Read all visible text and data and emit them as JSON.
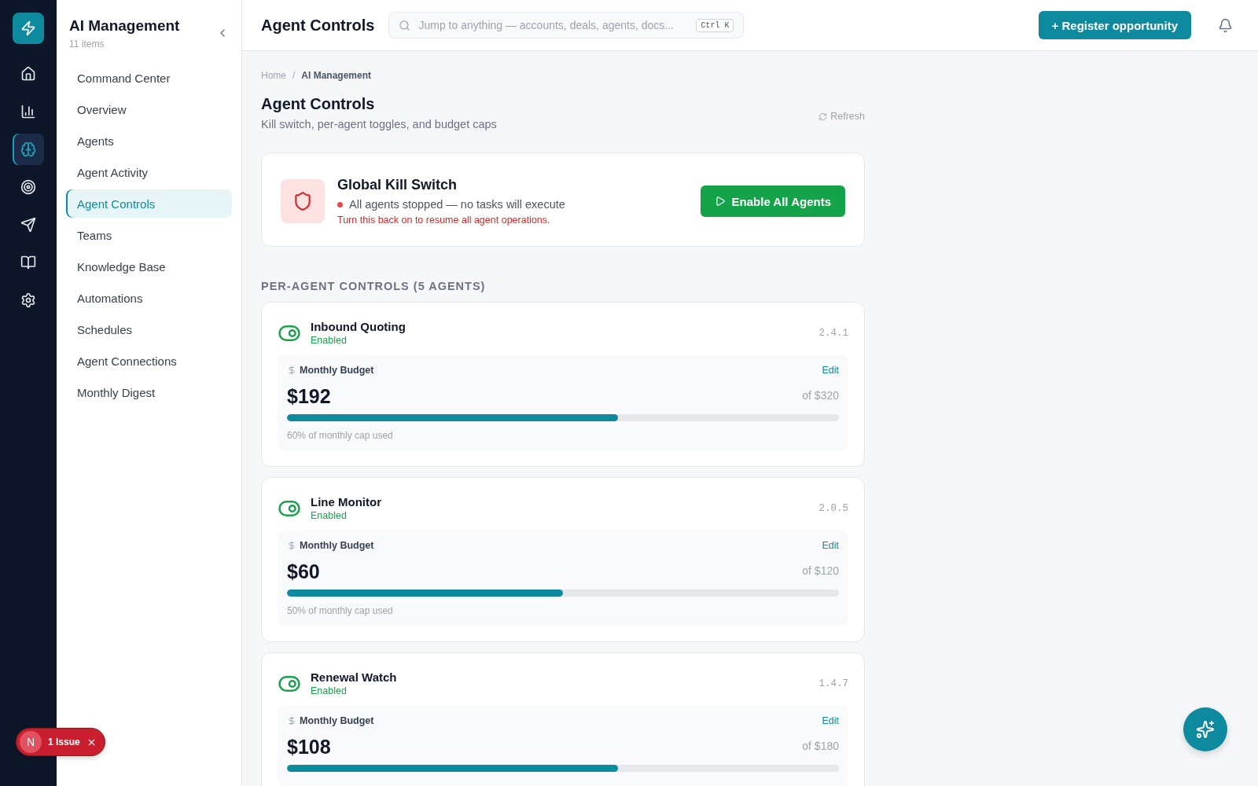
{
  "rail": {
    "items": [
      {
        "selected": false
      },
      {
        "selected": false
      },
      {
        "selected": true
      },
      {
        "selected": false
      },
      {
        "selected": false
      },
      {
        "selected": false
      },
      {
        "selected": false
      }
    ]
  },
  "sidebar": {
    "title": "AI Management",
    "count": "11 items",
    "items": [
      {
        "label": "Command Center",
        "selected": false
      },
      {
        "label": "Overview",
        "selected": false
      },
      {
        "label": "Agents",
        "selected": false
      },
      {
        "label": "Agent Activity",
        "selected": false
      },
      {
        "label": "Agent Controls",
        "selected": true
      },
      {
        "label": "Teams",
        "selected": false
      },
      {
        "label": "Knowledge Base",
        "selected": false
      },
      {
        "label": "Automations",
        "selected": false
      },
      {
        "label": "Schedules",
        "selected": false
      },
      {
        "label": "Agent Connections",
        "selected": false
      },
      {
        "label": "Monthly Digest",
        "selected": false
      }
    ]
  },
  "header": {
    "title": "Agent Controls",
    "search": {
      "placeholder": "Jump to anything — accounts, deals, agents, docs...",
      "shortcut": "Ctrl K"
    },
    "primary_button": "+ Register opportunity"
  },
  "breadcrumb": {
    "items": [
      "Home",
      "AI Management"
    ],
    "separator": "/"
  },
  "page": {
    "title": "Agent Controls",
    "subtitle": "Kill switch, per-agent toggles, and budget caps",
    "refresh": "Refresh"
  },
  "kill_switch": {
    "title": "Global Kill Switch",
    "status": "All agents stopped — no tasks will execute",
    "hint": "Turn this back on to resume all agent operations.",
    "button": "Enable All Agents"
  },
  "section_title": "PER-AGENT CONTROLS (5 AGENTS)",
  "agents": [
    {
      "name": "Inbound Quoting",
      "enabled": true,
      "status": "Enabled",
      "version": "2.4.1",
      "budget_label": "Monthly Budget",
      "edit": "Edit",
      "spent": "$192",
      "cap": "of $320",
      "level": 0.6,
      "note": "60% of monthly cap used"
    },
    {
      "name": "Line Monitor",
      "enabled": true,
      "status": "Enabled",
      "version": "2.0.5",
      "budget_label": "Monthly Budget",
      "edit": "Edit",
      "spent": "$60",
      "cap": "of $120",
      "level": 0.5,
      "note": "50% of monthly cap used"
    },
    {
      "name": "Renewal Watch",
      "enabled": true,
      "status": "Enabled",
      "version": "1.4.7",
      "budget_label": "Monthly Budget",
      "edit": "Edit",
      "spent": "$108",
      "cap": "of $180",
      "level": 0.6
    }
  ],
  "issue_badge": {
    "avatar": "N",
    "label": "1 Issue"
  }
}
